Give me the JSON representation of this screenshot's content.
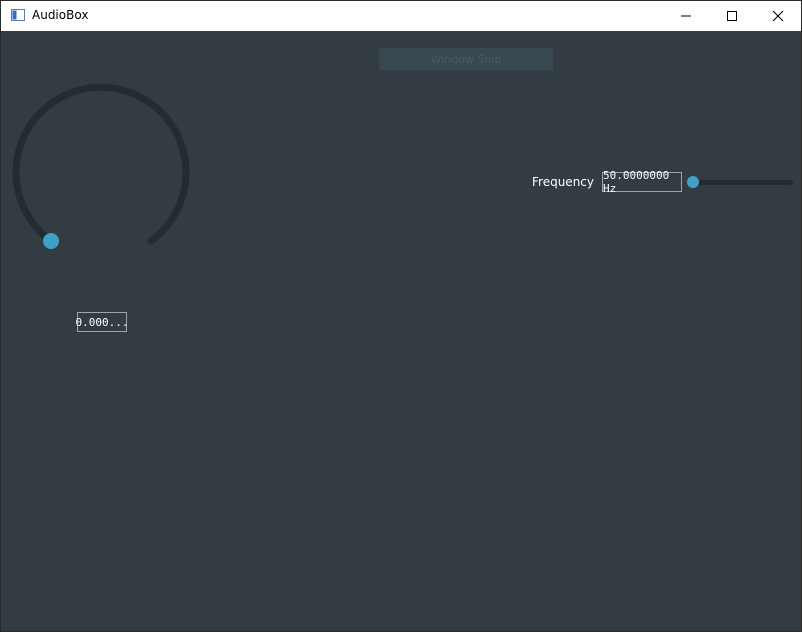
{
  "window": {
    "title": "AudioBox",
    "icons": {
      "app": "window-app-icon",
      "minimize": "minimize-icon",
      "maximize": "maximize-icon",
      "close": "close-icon"
    }
  },
  "overlay": {
    "snip_label": "Window Snip"
  },
  "knob": {
    "value_text": "0.000...",
    "level": 0.0
  },
  "frequency": {
    "label": "Frequency",
    "value_text": "50.0000000 Hz",
    "slider_level": 0.0
  },
  "colors": {
    "background": "#333c43",
    "accent": "#3fa0c8",
    "track": "#232c32"
  }
}
